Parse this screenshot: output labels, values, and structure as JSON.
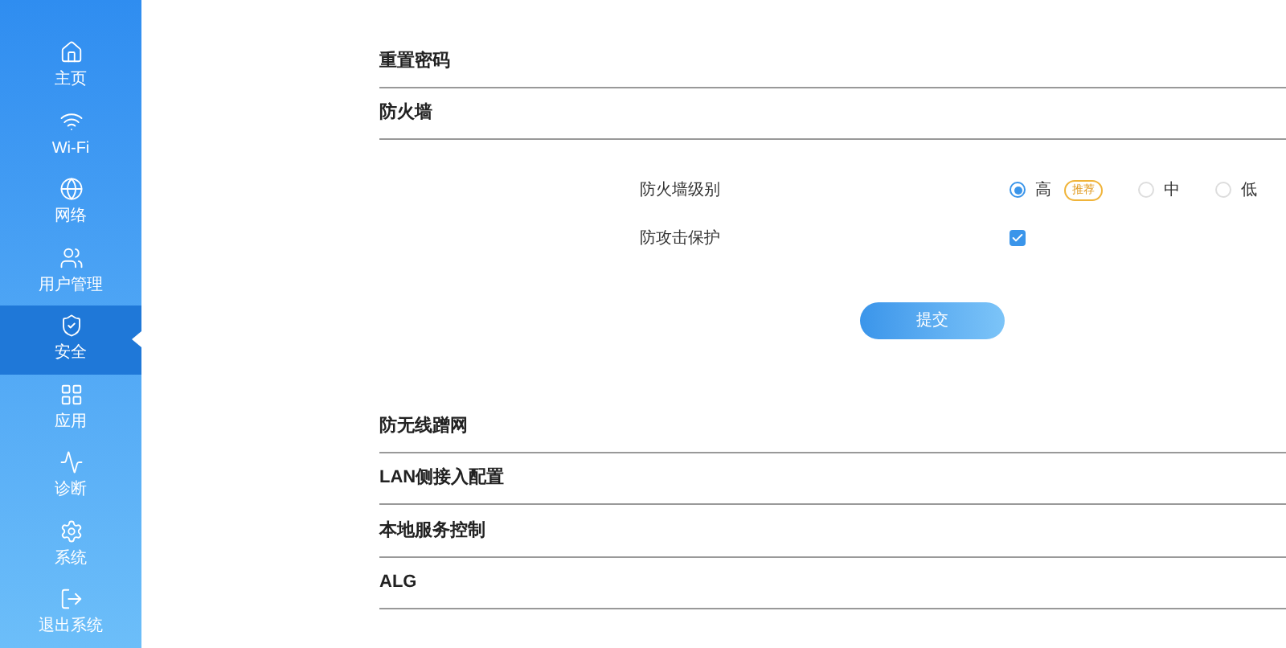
{
  "sidebar": {
    "items": [
      {
        "label": "主页",
        "selected": false
      },
      {
        "label": "Wi-Fi",
        "selected": false
      },
      {
        "label": "网络",
        "selected": false
      },
      {
        "label": "用户管理",
        "selected": false
      },
      {
        "label": "安全",
        "selected": true
      },
      {
        "label": "应用",
        "selected": false
      },
      {
        "label": "诊断",
        "selected": false
      },
      {
        "label": "系统",
        "selected": false
      },
      {
        "label": "退出系统",
        "selected": false
      }
    ]
  },
  "sections": [
    {
      "title": "重置密码"
    },
    {
      "title": "防火墙",
      "fields": [
        {
          "kind": "radio",
          "label": "防火墙级别",
          "options": [
            {
              "label": "高",
              "badge": "推荐",
              "selected": true
            },
            {
              "label": "中",
              "selected": false
            },
            {
              "label": "低",
              "selected": false
            }
          ]
        },
        {
          "kind": "checkbox",
          "label": "防攻击保护",
          "checked": true
        }
      ],
      "submit": "提交"
    },
    {
      "title": "防无线蹭网"
    },
    {
      "title": "LAN侧接入配置"
    },
    {
      "title": "本地服务控制"
    },
    {
      "title": "ALG"
    }
  ]
}
